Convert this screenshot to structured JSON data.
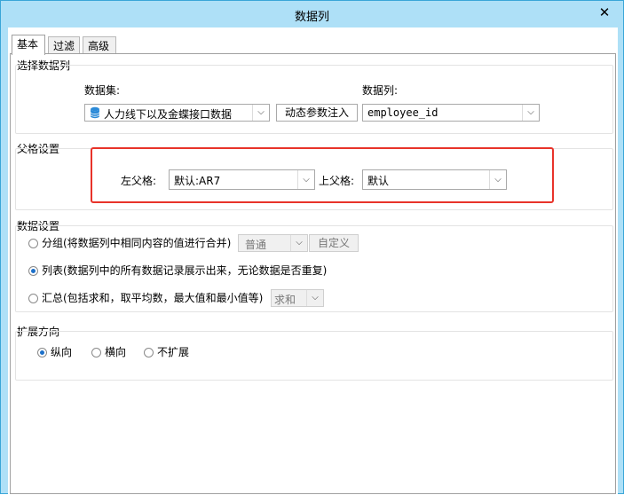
{
  "window": {
    "title": "数据列",
    "close_glyph": "✕"
  },
  "tabs": [
    {
      "label": "基本",
      "active": true
    },
    {
      "label": "过滤",
      "active": false
    },
    {
      "label": "高级",
      "active": false
    }
  ],
  "select_column": {
    "group_title": "选择数据列",
    "dataset_label": "数据集:",
    "dataset_value": "人力线下以及金蝶接口数据",
    "dynamic_param_button": "动态参数注入",
    "column_label": "数据列:",
    "column_value": "employee_id"
  },
  "parent_settings": {
    "group_title": "父格设置",
    "left_parent_label": "左父格:",
    "left_parent_value": "默认:AR7",
    "top_parent_label": "上父格:",
    "top_parent_value": "默认",
    "highlight_color": "#e8332a"
  },
  "data_settings": {
    "group_title": "数据设置",
    "group_option": "分组(将数据列中相同内容的值进行合并)",
    "group_mode_value": "普通",
    "custom_button": "自定义",
    "list_option": "列表(数据列中的所有数据记录展示出来，无论数据是否重复)",
    "summary_option": "汇总(包括求和，取平均数，最大值和最小值等)",
    "summary_mode_value": "求和",
    "selected": "list"
  },
  "expand_direction": {
    "group_title": "扩展方向",
    "options": [
      "纵向",
      "横向",
      "不扩展"
    ],
    "selected": "纵向"
  },
  "colors": {
    "accent": "#1c70c9",
    "title_bar": "#aee0f7"
  }
}
